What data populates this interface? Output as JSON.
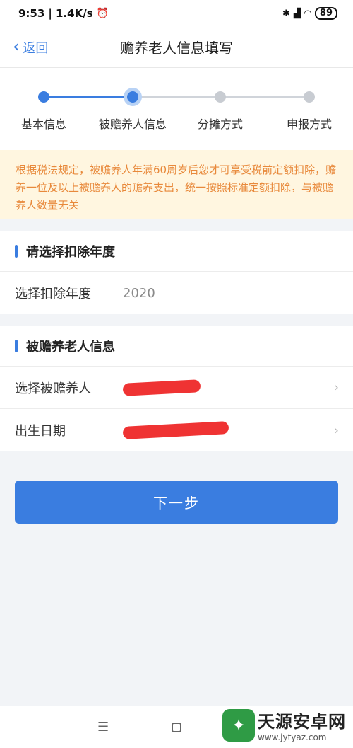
{
  "status": {
    "time": "9:53",
    "speed": "| 1.4K/s",
    "battery": "89"
  },
  "nav": {
    "back_label": "返回",
    "title": "赡养老人信息填写"
  },
  "steps": [
    {
      "label": "基本信息",
      "state": "done"
    },
    {
      "label": "被赡养人信息",
      "state": "current"
    },
    {
      "label": "分摊方式",
      "state": "todo"
    },
    {
      "label": "申报方式",
      "state": "todo"
    }
  ],
  "notice": "根据税法规定，被赡养人年满60周岁后您才可享受税前定额扣除，赡养一位及以上被赡养人的赡养支出，统一按照标准定额扣除，与被赡养人数量无关",
  "year_section": {
    "title": "请选择扣除年度",
    "row_label": "选择扣除年度",
    "row_value": "2020"
  },
  "elder_section": {
    "title": "被赡养老人信息",
    "rows": [
      {
        "label": "选择被赡养人"
      },
      {
        "label": "出生日期"
      }
    ]
  },
  "next_button": "下一步",
  "watermark": {
    "name": "天源安卓网",
    "url": "www.jytyaz.com"
  },
  "colors": {
    "accent": "#3a7de0",
    "notice_bg": "#fff6e0",
    "notice_text": "#e8893b"
  }
}
